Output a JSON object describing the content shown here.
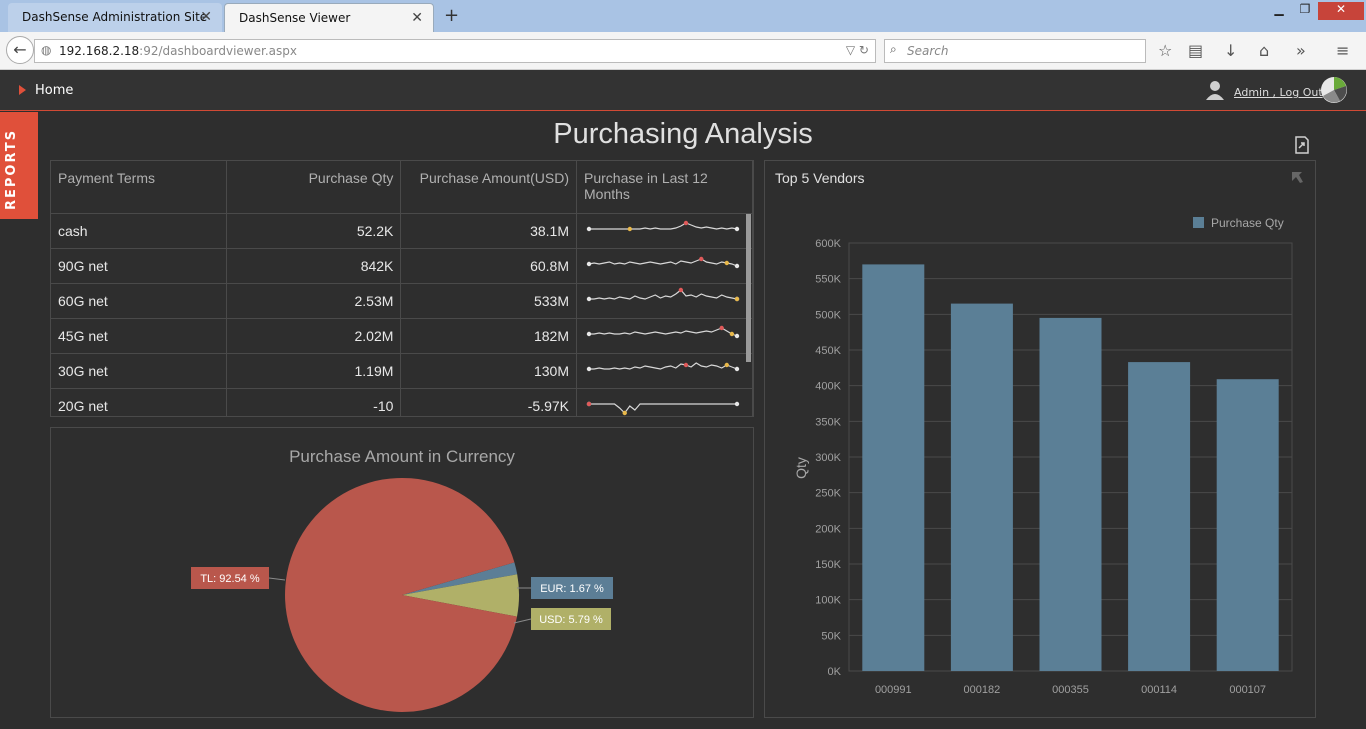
{
  "browser": {
    "tabs": [
      {
        "label": "DashSense Administration Site"
      },
      {
        "label": "DashSense Viewer"
      }
    ],
    "url_host": "192.168.2.18",
    "url_rest": ":92/dashboardviewer.aspx",
    "search_placeholder": "Search"
  },
  "header": {
    "home_label": "Home",
    "user_label": "Admin , Log Out"
  },
  "sidebar": {
    "reports_label": "REPORTS"
  },
  "page": {
    "title": "Purchasing Analysis"
  },
  "grid": {
    "columns": [
      "Payment Terms",
      "Purchase Qty",
      "Purchase Amount(USD)",
      "Purchase in Last 12 Months"
    ],
    "rows": [
      {
        "term": "cash",
        "qty": "52.2K",
        "amount": "38.1M"
      },
      {
        "term": "90G net",
        "qty": "842K",
        "amount": "60.8M"
      },
      {
        "term": "60G net",
        "qty": "2.53M",
        "amount": "533M"
      },
      {
        "term": "45G net",
        "qty": "2.02M",
        "amount": "182M"
      },
      {
        "term": "30G net",
        "qty": "1.19M",
        "amount": "130M"
      },
      {
        "term": "20G net",
        "qty": "-10",
        "amount": "-5.97K"
      }
    ]
  },
  "pie": {
    "title": "Purchase Amount in Currency",
    "slices": [
      {
        "label": "TL: 92.54 %",
        "value": 92.54,
        "color": "#b9574c"
      },
      {
        "label": "EUR: 1.67 %",
        "value": 1.67,
        "color": "#5c7e96"
      },
      {
        "label": "USD: 5.79 %",
        "value": 5.79,
        "color": "#b0b068"
      }
    ]
  },
  "bar": {
    "title": "Top 5 Vendors",
    "legend": "Purchase Qty"
  },
  "chart_data": {
    "type": "bar",
    "categories": [
      "000991",
      "000182",
      "000355",
      "000114",
      "000107"
    ],
    "series": [
      {
        "name": "Purchase Qty",
        "values": [
          570000,
          515000,
          495000,
          433000,
          409000
        ]
      }
    ],
    "ylabel": "Qty",
    "ylim": [
      0,
      600000
    ],
    "yticks": [
      "0K",
      "50K",
      "100K",
      "150K",
      "200K",
      "250K",
      "300K",
      "350K",
      "400K",
      "450K",
      "500K",
      "550K",
      "600K"
    ],
    "bar_color": "#5b7f96",
    "legend_position": "top-right",
    "grid": true
  }
}
